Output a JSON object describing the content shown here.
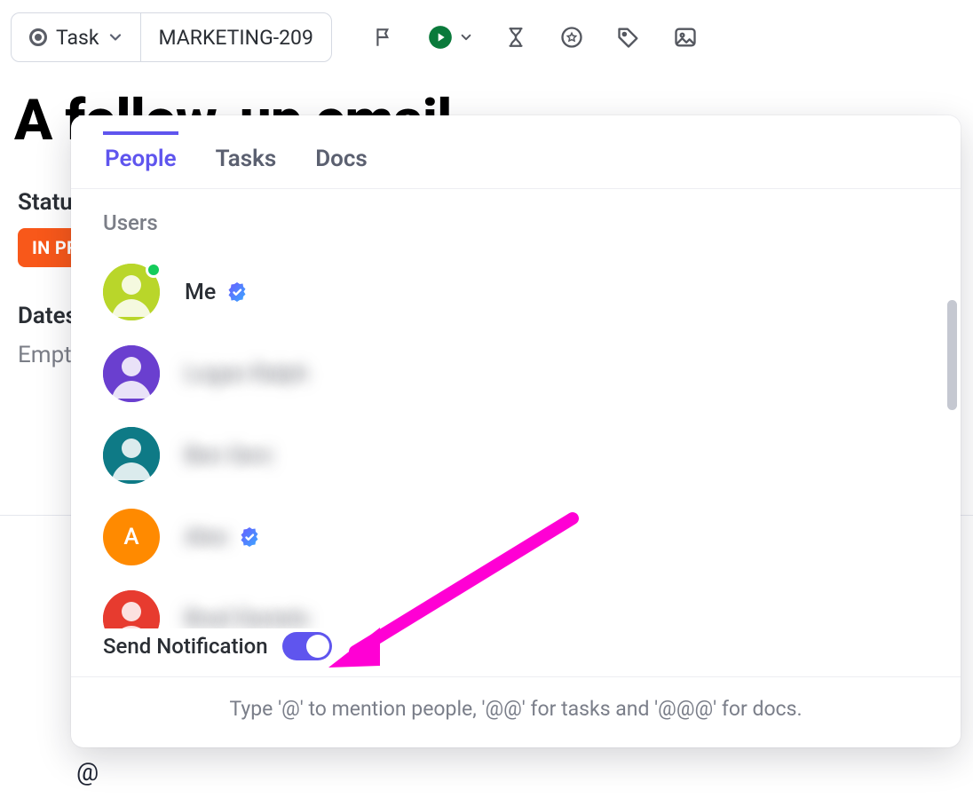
{
  "toolbar": {
    "type_label": "Task",
    "task_id": "MARKETING-209"
  },
  "title": "A follow-up email",
  "status": {
    "label": "Status",
    "value": "IN PROGRESS"
  },
  "dates": {
    "label": "Dates",
    "empty": "Empty"
  },
  "comment_prefix": "@",
  "popover": {
    "tabs": {
      "people": "People",
      "tasks": "Tasks",
      "docs": "Docs"
    },
    "section_label": "Users",
    "users": [
      {
        "name": "Me",
        "avatar_bg": "#b9d62a",
        "initial": "",
        "verified": true,
        "presence": true,
        "blurred": false
      },
      {
        "name": "Logan Ralph",
        "avatar_bg": "#6a3fcf",
        "initial": "",
        "verified": false,
        "presence": false,
        "blurred": true
      },
      {
        "name": "Ben Serz",
        "avatar_bg": "#0e7a86",
        "initial": "",
        "verified": false,
        "presence": false,
        "blurred": true
      },
      {
        "name": "Alex",
        "avatar_bg": "#ff8a00",
        "initial": "A",
        "verified": true,
        "presence": false,
        "blurred": true
      },
      {
        "name": "Brad Daniels",
        "avatar_bg": "#e73b2f",
        "initial": "",
        "verified": false,
        "presence": false,
        "blurred": true
      }
    ],
    "send_notification_label": "Send Notification",
    "send_notification_on": true,
    "hint": "Type '@' to mention people, '@@' for tasks and '@@@' for docs."
  },
  "annotation": {
    "arrow_color": "#ff00d4"
  }
}
